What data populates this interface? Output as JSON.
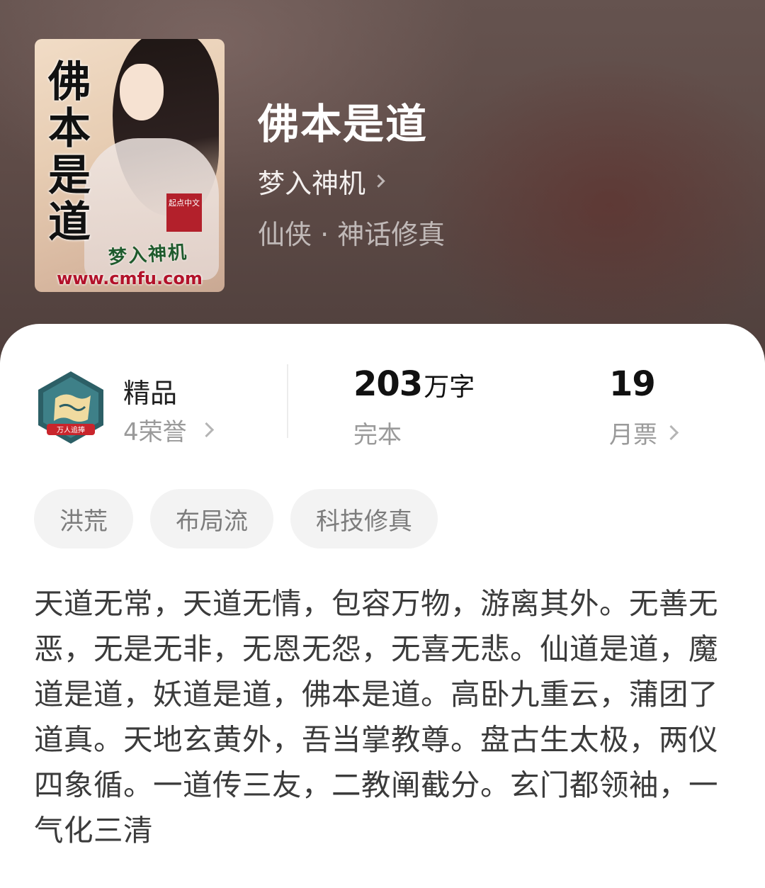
{
  "book": {
    "cover_title": "佛本是道",
    "cover_seal": "起点中文",
    "cover_author": "梦入神机",
    "cover_url": "www.cmfu.com",
    "title": "佛本是道",
    "author": "梦入神机",
    "category": "仙侠 · 神话修真"
  },
  "stats": {
    "honor": {
      "badge_ribbon": "万人追捧",
      "label": "精品",
      "sub": "4荣誉"
    },
    "words": {
      "value": "203",
      "unit": "万字",
      "status": "完本"
    },
    "tickets": {
      "value": "19",
      "label": "月票"
    }
  },
  "tags": [
    "洪荒",
    "布局流",
    "科技修真"
  ],
  "synopsis": "天道无常，天道无情，包容万物，游离其外。无善无恶，无是无非，无恩无怨，无喜无悲。仙道是道，魔道是道，妖道是道，佛本是道。高卧九重云，蒲团了道真。天地玄黄外，吾当掌教尊。盘古生太极，两仪四象循。一道传三友，二教阐截分。玄门都领袖，一气化三清",
  "colors": {
    "hero_bg": "#5e4b47",
    "card_bg": "#ffffff",
    "tag_bg": "#f3f3f3",
    "text_primary": "#111111",
    "text_secondary": "#9a9a9a"
  }
}
